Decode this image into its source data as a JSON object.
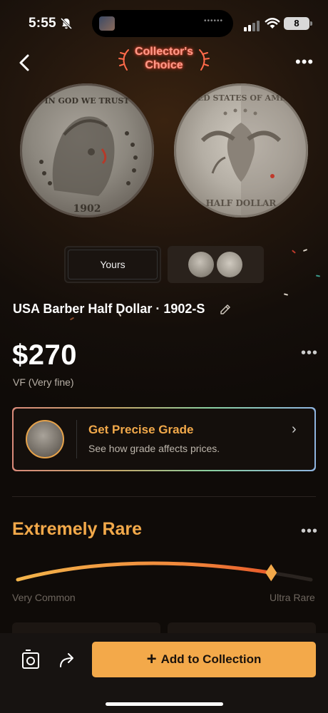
{
  "status_bar": {
    "time": "5:55",
    "battery": "8"
  },
  "header": {
    "badge_line1": "Collector's",
    "badge_line2": "Choice"
  },
  "thumbnails": {
    "yours_label": "Yours"
  },
  "coin": {
    "title": "USA Barber Half Dollar · 1902-S",
    "price": "$270",
    "grade": "VF (Very fine)"
  },
  "grade_card": {
    "title": "Get Precise Grade",
    "subtitle": "See how grade affects prices."
  },
  "rarity": {
    "title": "Extremely Rare",
    "min_label": "Very Common",
    "max_label": "Ultra Rare",
    "level": 0.88
  },
  "actions": {
    "add_label": "Add to Collection"
  },
  "colors": {
    "accent": "#f3a94a",
    "background": "#140e0a"
  }
}
